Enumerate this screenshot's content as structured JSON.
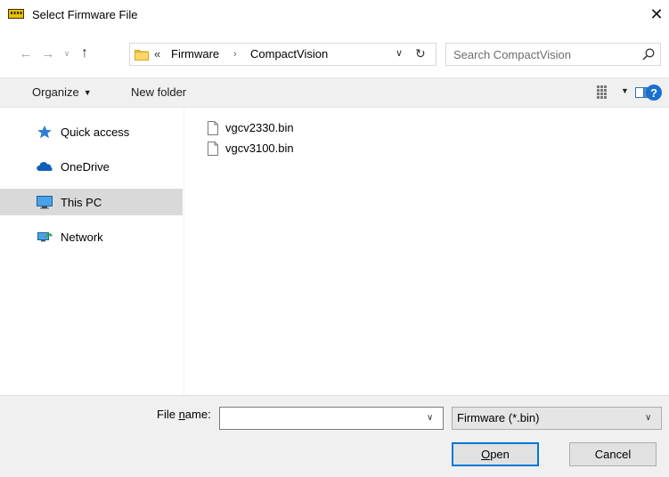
{
  "window": {
    "title": "Select Firmware File",
    "close_glyph": "✕",
    "icon": "serial-port-icon"
  },
  "navigation": {
    "back_glyph": "←",
    "forward_glyph": "→",
    "recent_glyph": "∨",
    "up_glyph": "↑"
  },
  "address": {
    "overflow_glyph": "«",
    "breadcrumbs": [
      "Firmware",
      "CompactVision"
    ],
    "separator_glyph": "›",
    "dropdown_glyph": "∨",
    "refresh_glyph": "↻"
  },
  "search": {
    "placeholder": "Search CompactVision"
  },
  "toolbar": {
    "organize_label": "Organize",
    "caret_glyph": "▼",
    "new_folder_label": "New folder",
    "help_glyph": "?"
  },
  "sidebar": {
    "items": [
      {
        "label": "Quick access",
        "icon": "star-icon",
        "selected": false
      },
      {
        "label": "OneDrive",
        "icon": "cloud-icon",
        "selected": false
      },
      {
        "label": "This PC",
        "icon": "monitor-icon",
        "selected": true
      },
      {
        "label": "Network",
        "icon": "network-icon",
        "selected": false
      }
    ]
  },
  "files": [
    {
      "name": "vgcv2330.bin",
      "icon": "file-icon"
    },
    {
      "name": "vgcv3100.bin",
      "icon": "file-icon"
    }
  ],
  "bottom": {
    "file_name_label_pre": "File ",
    "file_name_label_accel": "n",
    "file_name_label_post": "ame:",
    "file_name_value": "",
    "file_type": "Firmware (*.bin)",
    "dropdown_glyph": "∨",
    "open_accel": "O",
    "open_rest": "pen",
    "cancel_label": "Cancel"
  },
  "colors": {
    "accent": "#0078d7",
    "selection": "#d9d9d9",
    "toolbar_bg": "#f0f0f0",
    "help_blue": "#1a6fd0"
  }
}
